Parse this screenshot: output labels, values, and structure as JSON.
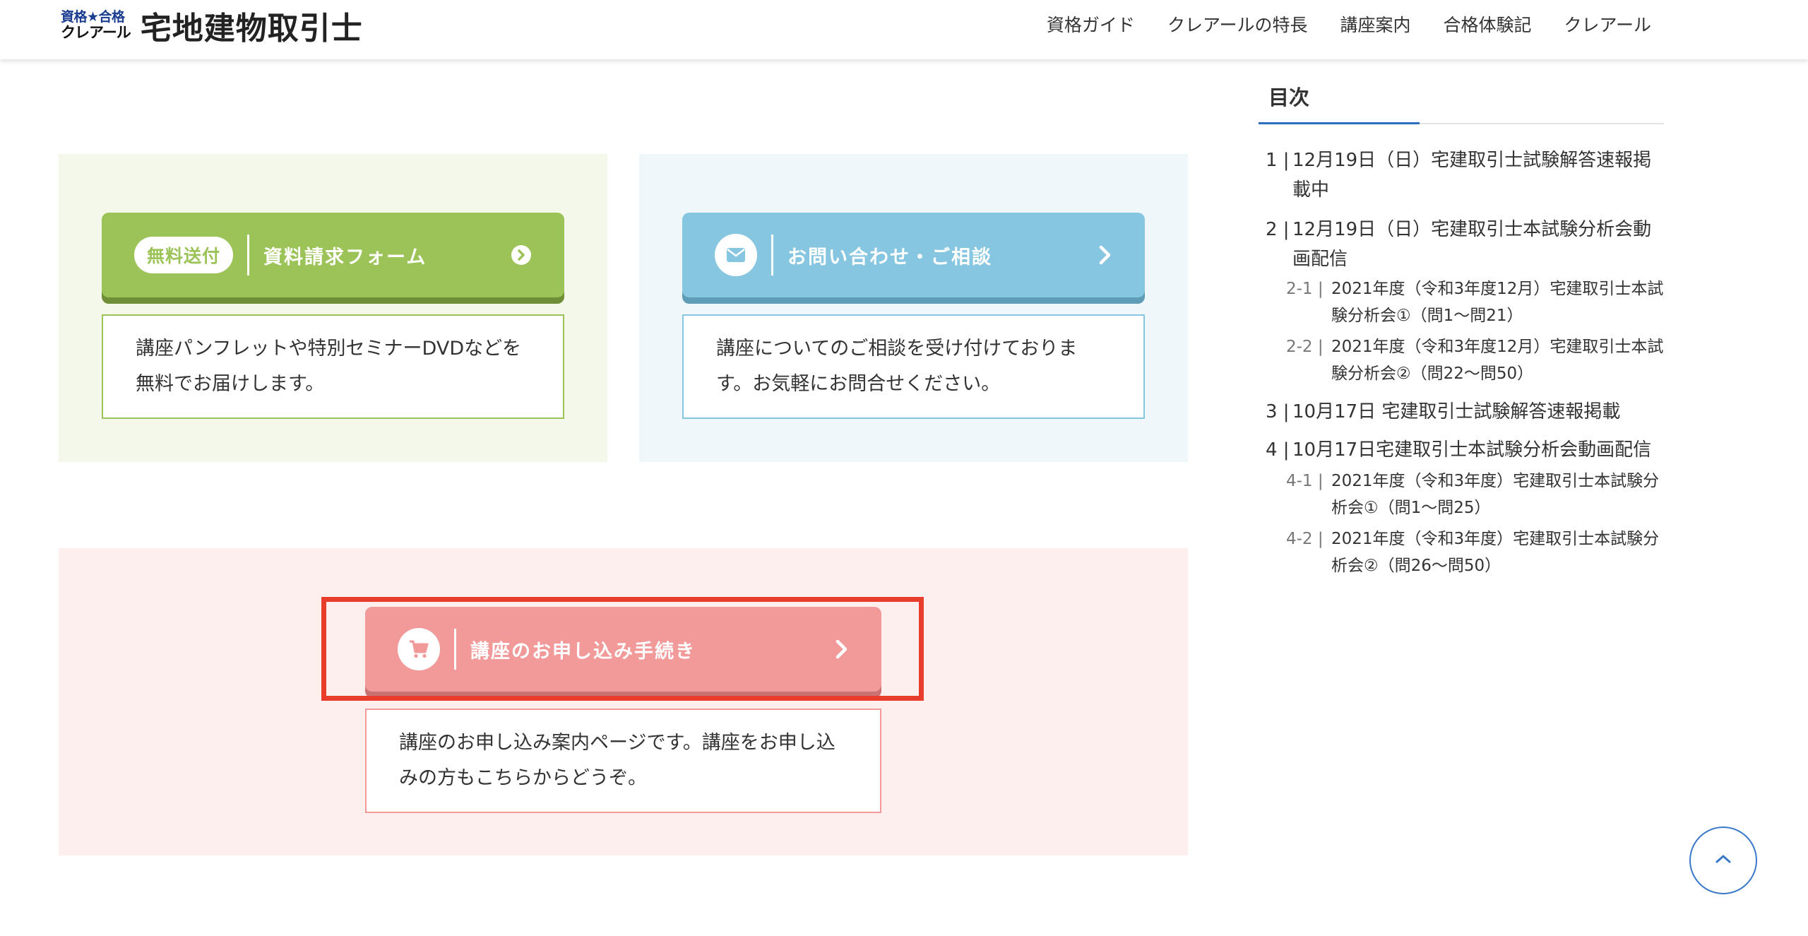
{
  "header": {
    "logo_line1": "資格★合格",
    "logo_line2": "クレアール",
    "site_title": "宅地建物取引士",
    "nav": [
      "資格ガイド",
      "クレアールの特長",
      "講座案内",
      "合格体験記",
      "クレアール"
    ]
  },
  "cta": {
    "materials": {
      "badge": "無料送付",
      "label": "資料請求フォーム",
      "description_line1": "講座パンフレットや特別セミナーDVDなどを",
      "description_line2": "無料でお届けします。"
    },
    "contact": {
      "label": "お問い合わせ・ご相談",
      "description_line1": "講座についてのご相談を受け付けておりま",
      "description_line2": "す。お気軽にお問合せください。"
    },
    "apply": {
      "label": "講座のお申し込み手続き",
      "description_line1": "講座のお申し込み案内ページです。講座をお申し込",
      "description_line2": "みの方もこちらからどうぞ。"
    }
  },
  "toc": {
    "title": "目次",
    "items": [
      {
        "num": "1",
        "line1": "12月19日（日）宅建取引士試験解答速報掲",
        "line2": "載中"
      },
      {
        "num": "2",
        "line1": "12月19日（日）宅建取引士本試験分析会動",
        "line2": "画配信"
      },
      {
        "num": "3",
        "line1": "10月17日 宅建取引士試験解答速報掲載",
        "line2": ""
      },
      {
        "num": "4",
        "line1": "10月17日宅建取引士本試験分析会動画配信",
        "line2": ""
      }
    ],
    "subitems": [
      {
        "num": "2-1",
        "line1": "2021年度（令和3年度12月）宅建取引士本試",
        "line2": "験分析会①（問1〜問21）"
      },
      {
        "num": "2-2",
        "line1": "2021年度（令和3年度12月）宅建取引士本試",
        "line2": "験分析会②（問22〜問50）"
      },
      {
        "num": "4-1",
        "line1": "2021年度（令和3年度）宅建取引士本試験分",
        "line2": "析会①（問1〜問25）"
      },
      {
        "num": "4-2",
        "line1": "2021年度（令和3年度）宅建取引士本試験分",
        "line2": "析会②（問26〜問50）"
      }
    ]
  },
  "colors": {
    "green": "#9cc358",
    "blue": "#86c6e0",
    "pink": "#f29a99",
    "highlight": "#e83d2c",
    "toc_accent": "#2d6fbd"
  },
  "icons": [
    "chevron-circle-right-icon",
    "envelope-icon",
    "cart-icon",
    "chevron-right-icon",
    "chevron-up-icon"
  ]
}
